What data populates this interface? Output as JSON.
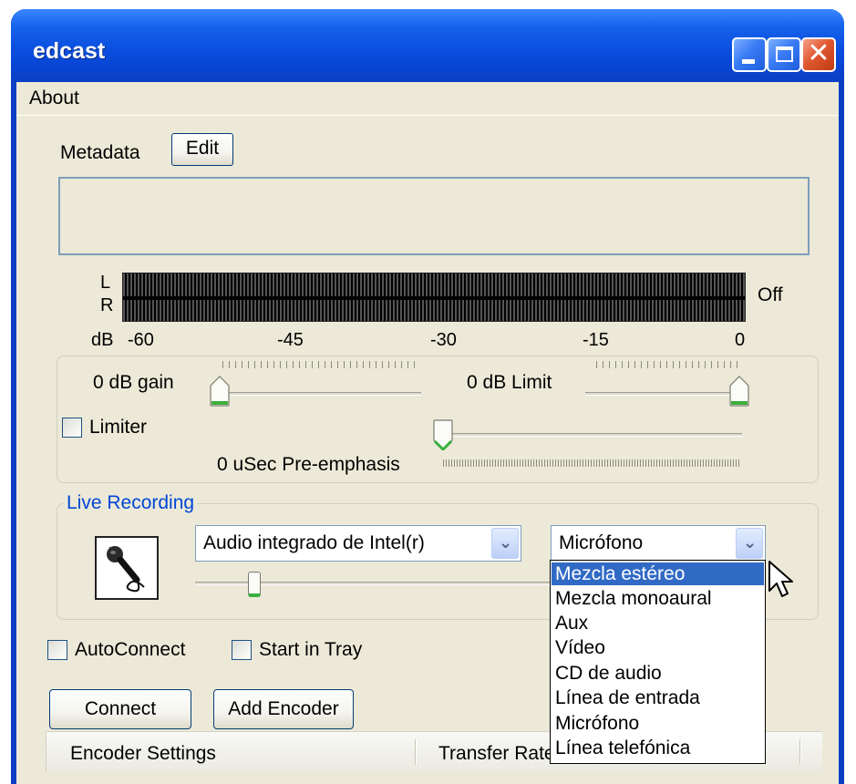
{
  "window": {
    "title": "edcast"
  },
  "menu": {
    "about": "About"
  },
  "metadata": {
    "label": "Metadata",
    "edit_button": "Edit",
    "text": ""
  },
  "vu_meter": {
    "channel_l": "L",
    "channel_r": "R",
    "status": "Off",
    "db_label": "dB",
    "ticks": [
      "-60",
      "-45",
      "-30",
      "-15",
      "0"
    ]
  },
  "gain": {
    "label": "0 dB gain",
    "level": 0.0
  },
  "limit": {
    "label": "0 dB Limit",
    "level": 1.0
  },
  "limiter": {
    "label": "Limiter",
    "checked": false
  },
  "preemphasis": {
    "label": "0  uSec Pre-emphasis",
    "level": 0.0
  },
  "live_recording": {
    "title": "Live Recording",
    "device_select": "Audio integrado de Intel(r)",
    "line_select": "Micrófono",
    "volume_level": 0.15,
    "line_options": [
      "Mezcla estéreo",
      "Mezcla monoaural",
      "Aux",
      "Vídeo",
      "CD de audio",
      "Línea de entrada",
      "Micrófono",
      "Línea telefónica"
    ],
    "highlighted_option": "Mezcla estéreo"
  },
  "options": {
    "autoconnect": "AutoConnect",
    "start_in_tray": "Start in Tray"
  },
  "buttons": {
    "connect": "Connect",
    "add_encoder": "Add Encoder"
  },
  "encoder_list": {
    "columns": [
      "Encoder Settings",
      "Transfer Rate"
    ]
  },
  "colors": {
    "titlebar": "#0b4fe0",
    "client_bg": "#ece9d8",
    "group_title": "#0046d5",
    "selection": "#316ac5",
    "thumb_accent": "#3cae3c"
  }
}
